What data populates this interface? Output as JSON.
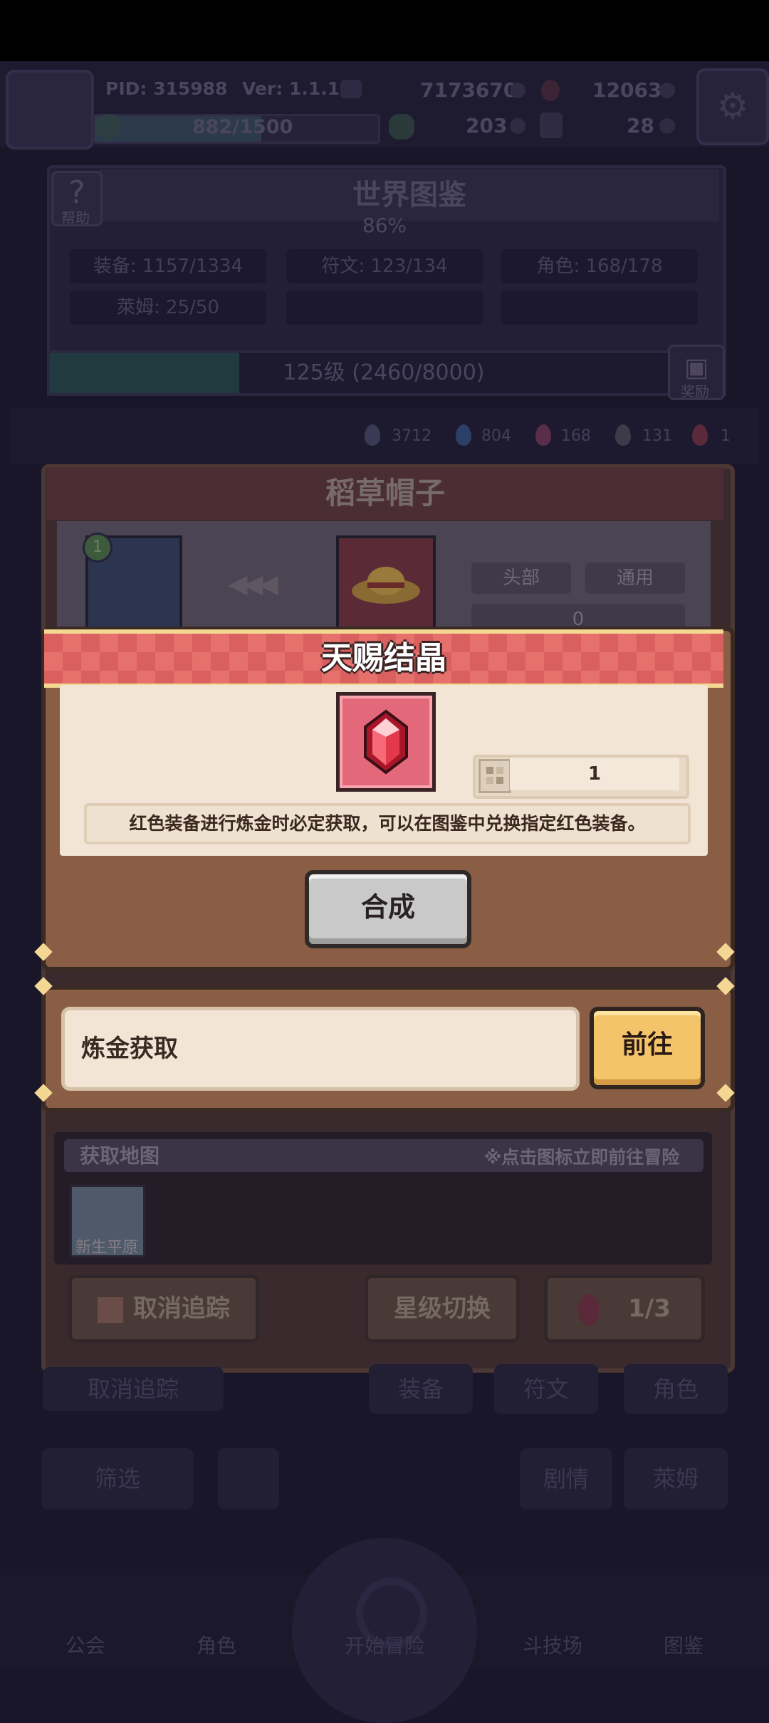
{
  "header": {
    "pid": "PID: 315988",
    "version": "Ver: 1.1.1.7",
    "xp": "882/1500",
    "gold": "7173670",
    "red_gems": "12063",
    "clover": "203",
    "keys": "28"
  },
  "codex": {
    "title": "世界图鉴",
    "help_label": "帮助",
    "percent": "86%",
    "stats": [
      "装备: 1157/1334",
      "符文: 123/134",
      "角色: 168/178",
      "萊姆: 25/50"
    ],
    "level": "125级 (2460/8000)",
    "level_progress": 0.3075,
    "reward_label": "奖励"
  },
  "gem_counts": [
    "3712",
    "804",
    "168",
    "131",
    "1"
  ],
  "gem_colors": [
    "#3b3a55",
    "#2c3f66",
    "#5a2e4a",
    "#3e3a4a",
    "#5a2a3a"
  ],
  "item": {
    "title": "稻草帽子",
    "char_level": "1",
    "slot_tag": "头部",
    "class_tag": "通用",
    "qty": "0",
    "map_header": "获取地图",
    "map_hint": "※点击图标立即前往冒险",
    "map_name": "新生平原",
    "untrack_label": "取消追踪",
    "star_switch_label": "星级切换",
    "star_count": "1/3"
  },
  "dialog": {
    "title": "天赐结晶",
    "quantity": "1",
    "description": "红色装备进行炼金时必定获取，可以在图鉴中兑换指定红色装备。",
    "synthesize_label": "合成",
    "source_label": "炼金获取",
    "go_label": "前往"
  },
  "background": {
    "untrack_label": "取消追踪",
    "tabs": [
      "装备",
      "符文",
      "角色"
    ],
    "filter_label": "筛选",
    "plot_label": "剧情",
    "slime_label": "萊姆"
  },
  "nav": [
    "公会",
    "角色",
    "开始冒险",
    "斗技场",
    "图鉴"
  ]
}
